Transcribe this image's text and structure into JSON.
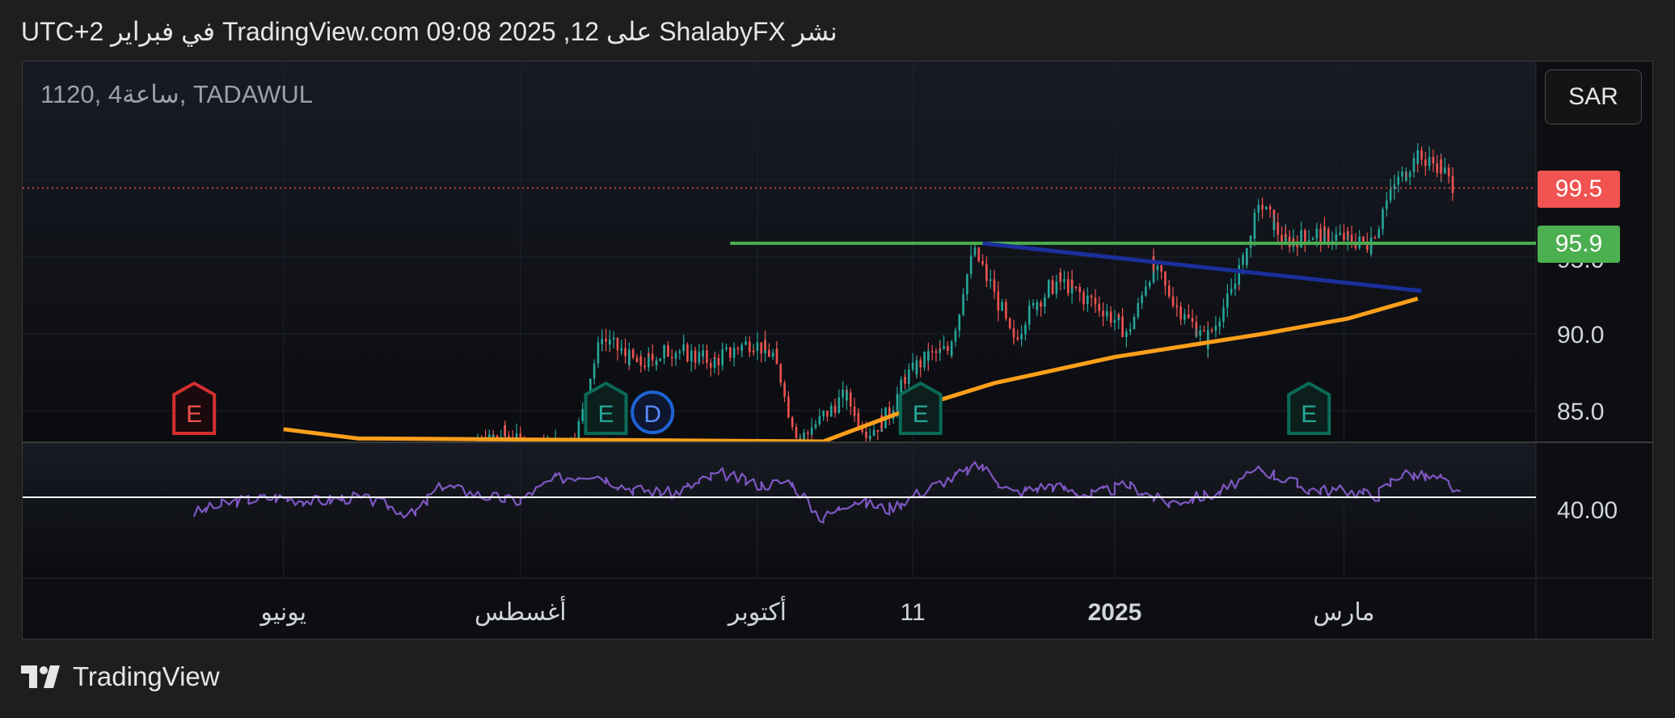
{
  "caption": "نشر ShalabyFX على TradingView.com 09:08 2025 ,12 في فبراير UTC+2",
  "symbol_title": "1120, 4ساعة, TADAWUL",
  "currency_button": "SAR",
  "current_price_tag": "99.5",
  "level_price_tag": "95.9",
  "brand": "TradingView",
  "colors": {
    "up": "#26a69a",
    "down": "#ef5350",
    "ma": "#ff9f1a",
    "resistance": "#4caf50",
    "trendline": "#1b2f9c",
    "rsi": "#7e57c2",
    "current_price": "#f05350"
  },
  "chart_data": [
    {
      "type": "candlestick",
      "symbol": "1120",
      "exchange": "TADAWUL",
      "interval": "4ساعة",
      "currency": "SAR",
      "x_tick_labels": [
        "يونيو",
        "أغسطس",
        "أكتوبر",
        "11",
        "2025",
        "مارس"
      ],
      "y_tick_labels": [
        "85.0",
        "90.0",
        "95.9",
        "99.5"
      ],
      "ylim": [
        82.0,
        107.0
      ],
      "last_price": 99.5,
      "horizontal_level": 95.9,
      "close_path": [
        {
          "x": "2024-07-14",
          "y": 81.5
        },
        {
          "x": "2024-07-28",
          "y": 83.5
        },
        {
          "x": "2024-08-05",
          "y": 82.3
        },
        {
          "x": "2024-08-16",
          "y": 83.2
        },
        {
          "x": "2024-08-22",
          "y": 89.8
        },
        {
          "x": "2024-09-01",
          "y": 88.0
        },
        {
          "x": "2024-09-10",
          "y": 89.0
        },
        {
          "x": "2024-09-20",
          "y": 88.2
        },
        {
          "x": "2024-09-30",
          "y": 89.5
        },
        {
          "x": "2024-10-06",
          "y": 88.5
        },
        {
          "x": "2024-10-12",
          "y": 83.0
        },
        {
          "x": "2024-10-18",
          "y": 84.5
        },
        {
          "x": "2024-10-24",
          "y": 86.0
        },
        {
          "x": "2024-10-30",
          "y": 83.5
        },
        {
          "x": "2024-11-05",
          "y": 85.0
        },
        {
          "x": "2024-11-08",
          "y": 87.0
        },
        {
          "x": "2024-11-14",
          "y": 88.5
        },
        {
          "x": "2024-11-20",
          "y": 89.0
        },
        {
          "x": "2024-11-26",
          "y": 95.5
        },
        {
          "x": "2024-12-02",
          "y": 92.5
        },
        {
          "x": "2024-12-06",
          "y": 89.5
        },
        {
          "x": "2024-12-12",
          "y": 92.0
        },
        {
          "x": "2024-12-18",
          "y": 93.5
        },
        {
          "x": "2024-12-24",
          "y": 92.5
        },
        {
          "x": "2024-12-30",
          "y": 91.5
        },
        {
          "x": "2025-01-05",
          "y": 90.0
        },
        {
          "x": "2025-01-11",
          "y": 94.5
        },
        {
          "x": "2025-01-17",
          "y": 92.0
        },
        {
          "x": "2025-01-25",
          "y": 89.5
        },
        {
          "x": "2025-01-31",
          "y": 92.5
        },
        {
          "x": "2025-02-04",
          "y": 95.0
        },
        {
          "x": "2025-02-08",
          "y": 98.5
        },
        {
          "x": "2025-02-14",
          "y": 96.0
        },
        {
          "x": "2025-02-22",
          "y": 96.5
        },
        {
          "x": "2025-03-02",
          "y": 96.2
        },
        {
          "x": "2025-03-08",
          "y": 95.8
        },
        {
          "x": "2025-03-14",
          "y": 99.5
        },
        {
          "x": "2025-03-20",
          "y": 101.5
        },
        {
          "x": "2025-03-26",
          "y": 101.0
        },
        {
          "x": "2025-03-30",
          "y": 99.5
        }
      ],
      "moving_average": [
        {
          "x": "2024-06-01",
          "y": 83.8
        },
        {
          "x": "2024-06-20",
          "y": 83.2
        },
        {
          "x": "2024-10-18",
          "y": 83.0
        },
        {
          "x": "2024-11-08",
          "y": 85.0
        },
        {
          "x": "2024-12-01",
          "y": 86.8
        },
        {
          "x": "2025-01-01",
          "y": 88.5
        },
        {
          "x": "2025-02-08",
          "y": 90.0
        },
        {
          "x": "2025-03-02",
          "y": 91.0
        },
        {
          "x": "2025-03-20",
          "y": 92.3
        }
      ],
      "horizontal_line": {
        "x_start": "2024-09-24",
        "x_end": "2025-04-25",
        "y": 95.9
      },
      "trendline": {
        "x_start": "2024-11-28",
        "y_start": 95.9,
        "x_end": "2025-03-21",
        "y_end": 92.8
      },
      "event_markers": [
        {
          "label": "E",
          "x": "2024-05-09",
          "kind": "earnings",
          "color": "#d32f2f"
        },
        {
          "label": "E",
          "x": "2024-08-23",
          "kind": "earnings",
          "color": "#0b6b58"
        },
        {
          "label": "D",
          "x": "2024-09-04",
          "kind": "dividend",
          "color": "#1e63d6"
        },
        {
          "label": "E",
          "x": "2024-11-12",
          "kind": "earnings",
          "color": "#0b6b58"
        },
        {
          "label": "E",
          "x": "2025-02-20",
          "kind": "earnings",
          "color": "#0b6b58"
        }
      ]
    },
    {
      "type": "line",
      "indicator": "RSI",
      "y_tick_labels": [
        "40.00"
      ],
      "ylim": [
        20.0,
        80.0
      ],
      "reference_line": 46.0,
      "series": [
        {
          "values": [
            {
              "x": "2024-05-09",
              "y": 38.0
            },
            {
              "x": "2024-05-20",
              "y": 44.0
            },
            {
              "x": "2024-05-30",
              "y": 46.0
            },
            {
              "x": "2024-06-10",
              "y": 44.0
            },
            {
              "x": "2024-06-20",
              "y": 46.0
            },
            {
              "x": "2024-06-28",
              "y": 42.0
            },
            {
              "x": "2024-07-05",
              "y": 37.0
            },
            {
              "x": "2024-07-12",
              "y": 52.0
            },
            {
              "x": "2024-07-22",
              "y": 47.0
            },
            {
              "x": "2024-08-01",
              "y": 44.0
            },
            {
              "x": "2024-08-10",
              "y": 55.0
            },
            {
              "x": "2024-08-20",
              "y": 58.0
            },
            {
              "x": "2024-08-30",
              "y": 50.0
            },
            {
              "x": "2024-09-10",
              "y": 48.0
            },
            {
              "x": "2024-09-22",
              "y": 58.0
            },
            {
              "x": "2024-10-02",
              "y": 52.0
            },
            {
              "x": "2024-10-10",
              "y": 54.0
            },
            {
              "x": "2024-10-18",
              "y": 35.0
            },
            {
              "x": "2024-10-26",
              "y": 45.0
            },
            {
              "x": "2024-11-04",
              "y": 40.0
            },
            {
              "x": "2024-11-14",
              "y": 50.0
            },
            {
              "x": "2024-11-28",
              "y": 62.0
            },
            {
              "x": "2024-12-06",
              "y": 48.0
            },
            {
              "x": "2024-12-16",
              "y": 52.0
            },
            {
              "x": "2024-12-26",
              "y": 47.0
            },
            {
              "x": "2025-01-05",
              "y": 52.0
            },
            {
              "x": "2025-01-15",
              "y": 43.0
            },
            {
              "x": "2025-01-28",
              "y": 48.0
            },
            {
              "x": "2025-02-08",
              "y": 60.0
            },
            {
              "x": "2025-02-20",
              "y": 50.0
            },
            {
              "x": "2025-03-02",
              "y": 49.0
            },
            {
              "x": "2025-03-10",
              "y": 47.0
            },
            {
              "x": "2025-03-16",
              "y": 58.0
            },
            {
              "x": "2025-03-26",
              "y": 55.0
            },
            {
              "x": "2025-03-31",
              "y": 49.0
            }
          ]
        }
      ]
    }
  ]
}
